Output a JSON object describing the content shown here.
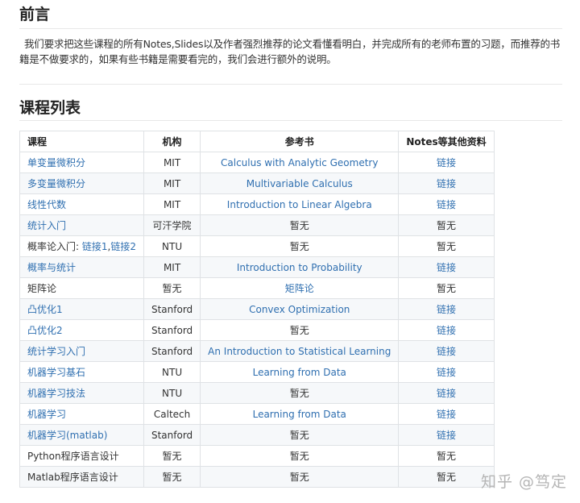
{
  "preface": {
    "heading": "前言",
    "paragraph": "我们要求把这些课程的所有Notes,Slides以及作者强烈推荐的论文看懂看明白，并完成所有的老师布置的习题，而推荐的书籍是不做要求的，如果有些书籍是需要看完的，我们会进行额外的说明。"
  },
  "course_list": {
    "heading": "课程列表",
    "columns": [
      "课程",
      "机构",
      "参考书",
      "Notes等其他资料"
    ],
    "rows": [
      {
        "course": "单变量微积分",
        "course_link": true,
        "org": "MIT",
        "book": "Calculus with Analytic Geometry",
        "book_link": true,
        "notes": "链接",
        "notes_link": true
      },
      {
        "course": "多变量微积分",
        "course_link": true,
        "org": "MIT",
        "book": "Multivariable Calculus",
        "book_link": true,
        "notes": "链接",
        "notes_link": true
      },
      {
        "course": "线性代数",
        "course_link": true,
        "org": "MIT",
        "book": "Introduction to Linear Algebra",
        "book_link": true,
        "notes": "链接",
        "notes_link": true
      },
      {
        "course": "统计入门",
        "course_link": true,
        "org": "可汗学院",
        "book": "暂无",
        "book_link": false,
        "notes": "暂无",
        "notes_link": false
      },
      {
        "course_prefix": "概率论入门: ",
        "course_links": [
          "链接1",
          "链接2"
        ],
        "org": "NTU",
        "book": "暂无",
        "book_link": false,
        "notes": "暂无",
        "notes_link": false
      },
      {
        "course": "概率与统计",
        "course_link": true,
        "org": "MIT",
        "book": "Introduction to Probability",
        "book_link": true,
        "notes": "链接",
        "notes_link": true
      },
      {
        "course": "矩阵论",
        "course_link": false,
        "org": "暂无",
        "book": "矩阵论",
        "book_link": true,
        "notes": "暂无",
        "notes_link": false
      },
      {
        "course": "凸优化1",
        "course_link": true,
        "org": "Stanford",
        "book": "Convex Optimization",
        "book_link": true,
        "notes": "链接",
        "notes_link": true
      },
      {
        "course": "凸优化2",
        "course_link": true,
        "org": "Stanford",
        "book": "暂无",
        "book_link": false,
        "notes": "链接",
        "notes_link": true
      },
      {
        "course": "统计学习入门",
        "course_link": true,
        "org": "Stanford",
        "book": "An Introduction to Statistical Learning",
        "book_link": true,
        "notes": "链接",
        "notes_link": true
      },
      {
        "course": "机器学习基石",
        "course_link": true,
        "org": "NTU",
        "book": "Learning from Data",
        "book_link": true,
        "notes": "链接",
        "notes_link": true
      },
      {
        "course": "机器学习技法",
        "course_link": true,
        "org": "NTU",
        "book": "暂无",
        "book_link": false,
        "notes": "链接",
        "notes_link": true
      },
      {
        "course": "机器学习",
        "course_link": true,
        "org": "Caltech",
        "book": "Learning from Data",
        "book_link": true,
        "notes": "链接",
        "notes_link": true
      },
      {
        "course": "机器学习(matlab)",
        "course_link": true,
        "org": "Stanford",
        "book": "暂无",
        "book_link": false,
        "notes": "链接",
        "notes_link": true
      },
      {
        "course": "Python程序语言设计",
        "course_link": false,
        "org": "暂无",
        "book": "暂无",
        "book_link": false,
        "notes": "暂无",
        "notes_link": false
      },
      {
        "course": "Matlab程序语言设计",
        "course_link": false,
        "org": "暂无",
        "book": "暂无",
        "book_link": false,
        "notes": "暂无",
        "notes_link": false
      }
    ]
  },
  "watermark": "知乎 @笃定",
  "colors": {
    "link": "#2f6fb0",
    "text": "#333333",
    "border": "#dfe2e5",
    "stripe": "#f6f8fa"
  }
}
